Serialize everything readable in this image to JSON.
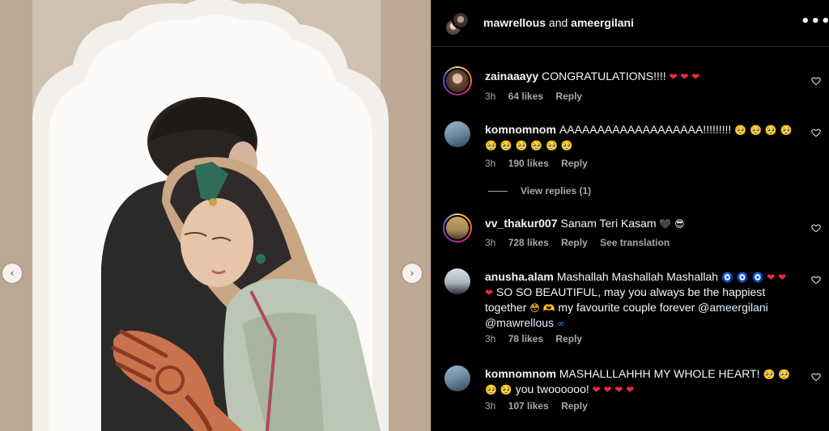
{
  "header": {
    "user1": "mawrellous",
    "joiner": "and",
    "user2": "ameergilani",
    "more_icon": "more-horizontal-icon"
  },
  "carousel": {
    "prev_icon": "chevron-left-icon",
    "next_icon": "chevron-right-icon",
    "prev_glyph": "‹",
    "next_glyph": "›"
  },
  "comments": [
    {
      "user": "zainaaayy",
      "text": "CONGRATULATIONS!!!!",
      "emoji": "❤ ❤ ❤",
      "time": "3h",
      "likes": "64 likes",
      "reply": "Reply"
    },
    {
      "user": "komnomnom",
      "text": "AAAAAAAAAAAAAAAAAAA!!!!!!!!!",
      "emoji": "🥺 🥺 🥺 🥺 🥺 🥺 🥺 🥺 🥺 🥺",
      "time": "3h",
      "likes": "190 likes",
      "reply": "Reply",
      "view_replies": "View replies (1)"
    },
    {
      "user": "vv_thakur007",
      "text": "Sanam Teri Kasam",
      "emoji": "🖤 😎",
      "time": "3h",
      "likes": "728 likes",
      "reply": "Reply",
      "translate": "See translation"
    },
    {
      "user": "anusha.alam",
      "text": "Mashallah Mashallah Mashallah",
      "emoji_a": "🧿 🧿 🧿",
      "emoji_b": "❤ ❤",
      "emoji_c": "❤",
      "text2": "SO SO BEAUTIFUL, may you always be the happiest together",
      "emoji_d": "😳 🫶",
      "text3": "my favourite couple forever",
      "mention1": "@ameergilani",
      "mention2": "@mawrellous",
      "emoji_e": "∞",
      "time": "3h",
      "likes": "78 likes",
      "reply": "Reply"
    },
    {
      "user": "komnomnom",
      "text": "MASHALLLAHHH MY WHOLE HEART!",
      "emoji_a": "🥺 🥺 🥺",
      "emoji_b": "🥺",
      "text2": "you twoooooo!",
      "emoji_c": "❤ ❤ ❤ ❤",
      "time": "3h",
      "likes": "107 likes",
      "reply": "Reply"
    }
  ],
  "colors": {
    "background": "#000000",
    "text": "#f5f5f5",
    "muted": "#a8a8a8",
    "heart": "#ed2b3a"
  }
}
